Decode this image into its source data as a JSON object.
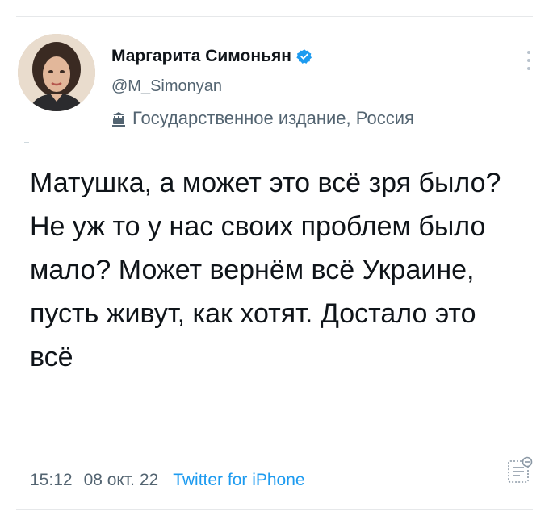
{
  "author": {
    "name": "Маргарита Симоньян",
    "handle": "@M_Simonyan",
    "label": "Государственное издание, Россия",
    "verified_color": "#1d9bf0"
  },
  "tweet": {
    "text": "Матушка, а может это всё зря было? Не уж то у нас своих проблем было мало? Может вернём всё Украине, пусть живут, как хотят. Достало это всё"
  },
  "meta": {
    "time": "15:12",
    "date": "08 окт. 22",
    "source": "Twitter for iPhone"
  },
  "icons": {
    "verified": "verified-badge-icon",
    "label": "government-building-icon",
    "more": "more-vertical-icon",
    "notes": "notes-icon"
  }
}
